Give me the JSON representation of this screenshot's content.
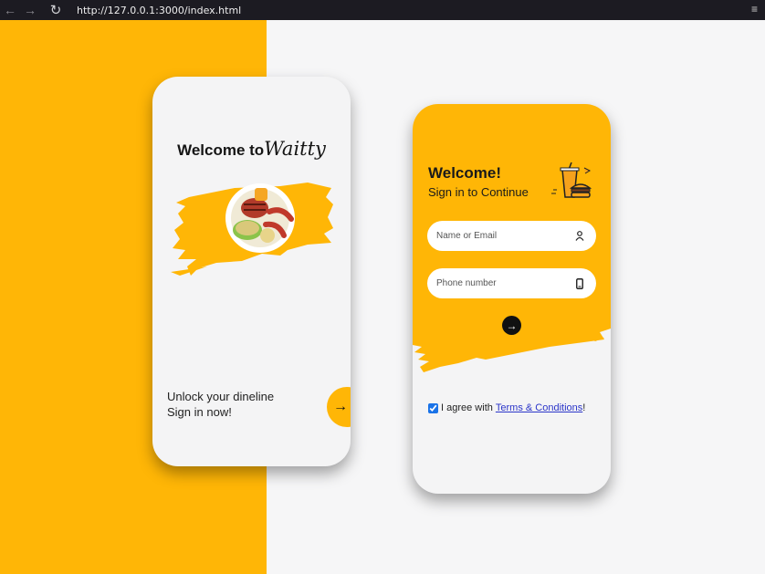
{
  "browser": {
    "back_icon": "arrow-left-icon",
    "forward_icon": "arrow-right-icon",
    "reload_icon": "reload-icon",
    "url": "http://127.0.0.1:3000/index.html",
    "menu_icon": "hamburger-menu-icon"
  },
  "colors": {
    "accent": "#ffb606",
    "card_bg": "#f4f4f5",
    "page_bg": "#f6f6f7",
    "dark": "#111111"
  },
  "intro_card": {
    "welcome_prefix": "Welcome to",
    "brand": "Waitty",
    "image_icon": "grilled-food-plate-icon",
    "tagline_line1": "Unlock your dineline",
    "tagline_line2": "Sign in now!",
    "next_arrow": "→"
  },
  "signin_card": {
    "title": "Welcome!",
    "subtitle": "Sign in to Continue",
    "illustration_icon": "fast-food-icon",
    "name_field": {
      "placeholder": "Name or Email",
      "value": "",
      "icon": "user-icon"
    },
    "phone_field": {
      "placeholder": "Phone number",
      "value": "",
      "icon": "mobile-phone-icon"
    },
    "submit_arrow": "→",
    "agree_text": "I agree with",
    "terms_link": "Terms & Conditions",
    "terms_suffix": "!",
    "agree_checked": true
  }
}
